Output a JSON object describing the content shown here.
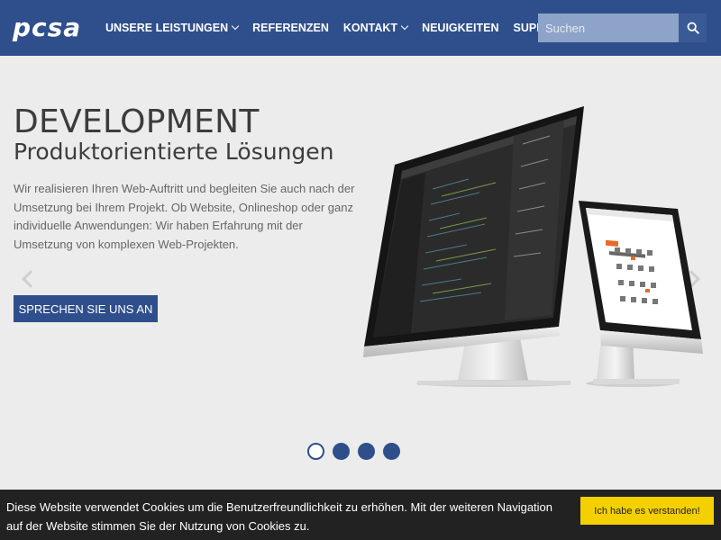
{
  "header": {
    "logo_text": "pcsa",
    "nav": [
      {
        "label": "UNSERE LEISTUNGEN",
        "dropdown": true
      },
      {
        "label": "REFERENZEN",
        "dropdown": false
      },
      {
        "label": "KONTAKT",
        "dropdown": true
      },
      {
        "label": "NEUIGKEITEN",
        "dropdown": false
      },
      {
        "label": "SUPPORT",
        "dropdown": false
      }
    ],
    "search": {
      "placeholder": "Suchen",
      "icon": "search-icon"
    }
  },
  "hero": {
    "title": "DEVELOPMENT",
    "subtitle": "Produktorientierte Lösungen",
    "text": "Wir realisieren Ihren Web-Auftritt und begleiten Sie auch nach der Umsetzung bei Ihrem Projekt. Ob Website, Onlineshop oder ganz individuelle Anwendungen: Wir haben Erfahrung mit der Umsetzung von komplexen Web-Projekten.",
    "cta_label": "SPRECHEN SIE UNS AN",
    "slides_total": 4,
    "active_slide": 1
  },
  "cookie": {
    "text": "Diese Website verwendet Cookies um die Benutzerfreundlichkeit zu erhöhen. Mit der weiteren Navigation auf der Website stimmen Sie der Nutzung von Cookies zu.",
    "button_label": "Ich habe es verstanden!"
  },
  "colors": {
    "brand": "#2f4f8c",
    "cookie_button": "#f5d000",
    "cookie_bar": "#222222"
  }
}
